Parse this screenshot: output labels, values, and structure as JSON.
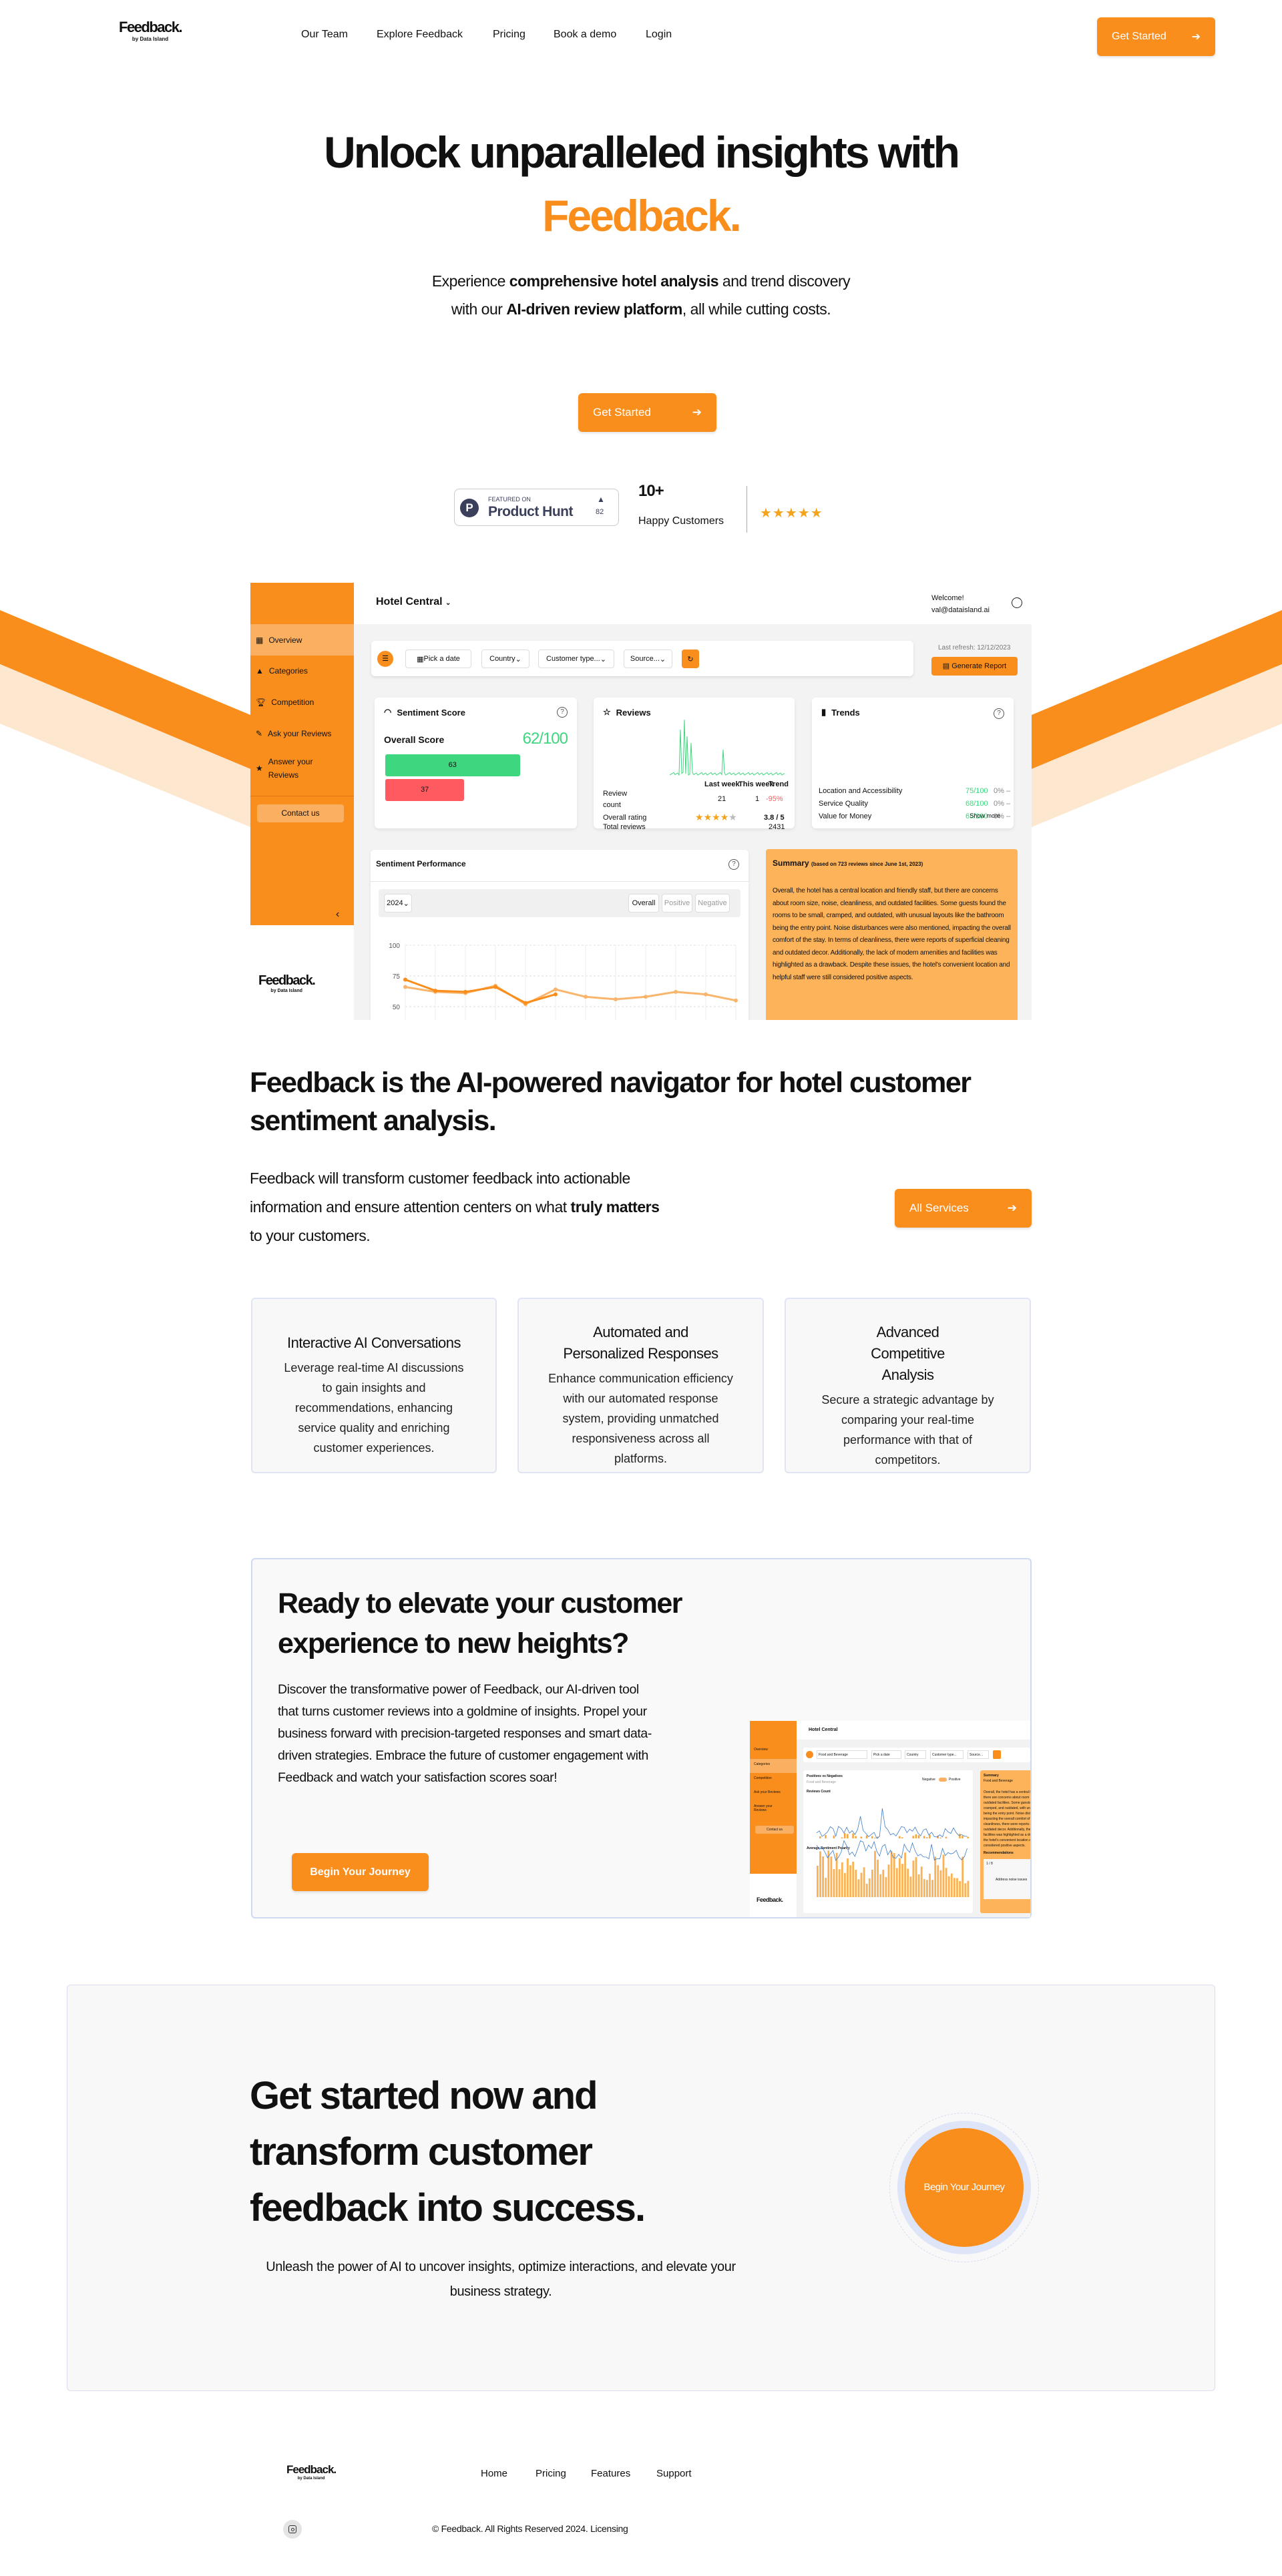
{
  "colors": {
    "accent": "#F98E1D",
    "accent_light": "#FBB061",
    "success": "#3ED67F",
    "danger": "#FF5A5F",
    "panel_bg": "#F8F8F9",
    "border": "#DFE5F5"
  },
  "brand": {
    "name": "Feedback.",
    "tagline": "by Data Island"
  },
  "nav": {
    "links": [
      "Our Team",
      "Explore Feedback",
      "Pricing",
      "Book a demo",
      "Login"
    ],
    "cta": "Get Started",
    "cta_icon": "arrow-right-icon"
  },
  "hero": {
    "title_line1": "Unlock unparalleled insights with",
    "title_line2": "Feedback.",
    "p1": "Experience ",
    "p1_b": "comprehensive hotel analysis",
    "p2": " and trend discovery with our ",
    "p2_b": "AI-driven review platform",
    "p3": ", all while cutting costs.",
    "cta": "Get Started",
    "product_hunt": {
      "featured": "FEATURED ON",
      "name": "Product Hunt",
      "votes": "82"
    },
    "customers_count": "10+",
    "customers_label": "Happy Customers",
    "stars": 5
  },
  "dashboard": {
    "hotel": "Hotel Central",
    "welcome": "Welcome!",
    "email": "val@dataisland.ai",
    "sidebar": [
      "Overview",
      "Categories",
      "Competition",
      "Ask your Reviews",
      "Answer your Reviews"
    ],
    "contact": "Contact us",
    "filters": [
      "Pick a date",
      "Country",
      "Customer type...",
      "Source..."
    ],
    "last_refresh": "Last refresh: 12/12/2023",
    "generate": "Generate Report",
    "sentiment": {
      "title": "Sentiment Score",
      "overall_label": "Overall Score",
      "overall": "62/100",
      "positive": 63,
      "negative": 37
    },
    "reviews": {
      "title": "Reviews",
      "headers": [
        "Last week",
        "This week",
        "Trend"
      ],
      "count_label": "Review count",
      "last_week": "21",
      "this_week": "1",
      "trend": "-95%",
      "rating_label": "Overall rating",
      "rating": 3.8,
      "rating_text": "3.8 / 5",
      "total_label": "Total reviews",
      "total": "2431"
    },
    "trends": {
      "title": "Trends",
      "rows": [
        {
          "name": "Location and Accessibility",
          "score": "75/100",
          "change": "0%"
        },
        {
          "name": "Service Quality",
          "score": "68/100",
          "change": "0%"
        },
        {
          "name": "Value for Money",
          "score": "65/100",
          "change": "0%"
        }
      ],
      "show_more": "Show more"
    },
    "performance": {
      "title": "Sentiment Performance",
      "year": "2024",
      "tabs": [
        "Overall",
        "Positive",
        "Negative"
      ],
      "yticks": [
        100,
        75,
        50
      ],
      "series_dark": [
        72,
        63,
        62,
        66,
        53,
        60
      ],
      "series_light": [
        66,
        62,
        61,
        67,
        52,
        64,
        58,
        56,
        58,
        62,
        60,
        55
      ]
    },
    "summary": {
      "title": "Summary",
      "note": "(based on 723 reviews since June 1st, 2023)",
      "text": "Overall, the hotel has a central location and friendly staff, but there are concerns about room size, noise, cleanliness, and outdated facilities. Some guests found the rooms to be small, cramped, and outdated, with unusual layouts like the bathroom being the entry point. Noise disturbances were also mentioned, impacting the overall comfort of the stay. In terms of cleanliness, there were reports of superficial cleaning and outdated decor. Additionally, the lack of modern amenities and facilities was highlighted as a drawback. Despite these issues, the hotel's convenient location and helpful staff were still considered positive aspects."
    }
  },
  "navigator": {
    "title": "Feedback is the AI-powered navigator for hotel customer sentiment analysis.",
    "p1": "Feedback will transform customer feedback into actionable information and ensure attention centers on what ",
    "p_b": "truly matters",
    "p2": " to your customers.",
    "cta": "All Services"
  },
  "features": [
    {
      "title": "Interactive AI Conversations",
      "body": "Leverage real-time AI discussions to gain insights and recommendations, enhancing service quality and enriching customer experiences."
    },
    {
      "title": "Automated and Personalized Responses",
      "body": "Enhance communication efficiency with our automated response system, providing unmatched responsiveness across all platforms."
    },
    {
      "title": "Advanced Competitive Analysis",
      "body": "Secure a strategic advantage by comparing your real-time performance with that of competitors."
    }
  ],
  "elevate": {
    "title": "Ready to elevate your customer experience to new heights?",
    "body": "Discover the transformative power of Feedback, our AI-driven tool that turns customer reviews into a goldmine of insights. Propel your business forward with precision-targeted responses and smart data-driven strategies. Embrace the future of customer engagement with Feedback and watch your satisfaction scores soar!",
    "cta": "Begin Your Journey",
    "mini": {
      "hotel": "Hotel Central",
      "category": "Food and Beverage",
      "chart1": "Positives vs Negatives",
      "chart1_sub": "Food and Beverage",
      "toggle_left": "Negative",
      "toggle_right": "Positive",
      "count_title": "Reviews Count",
      "polarity_title": "Average Sentiment Polarity",
      "summary": "Summary",
      "recommendations": "Recommendations",
      "rec_page": "1 / 8",
      "rec_text": "Address noise issues"
    }
  },
  "final": {
    "title": "Get started now and transform customer feedback into success.",
    "body": "Unleash the power of AI to uncover insights, optimize interactions, and elevate your business strategy.",
    "cta": "Begin Your Journey"
  },
  "footer": {
    "links": [
      "Home",
      "Pricing",
      "Features",
      "Support"
    ],
    "copyright": "© Feedback. All Rights Reserved 2024.",
    "licensing": "Licensing",
    "social_icon": "instagram-icon"
  }
}
